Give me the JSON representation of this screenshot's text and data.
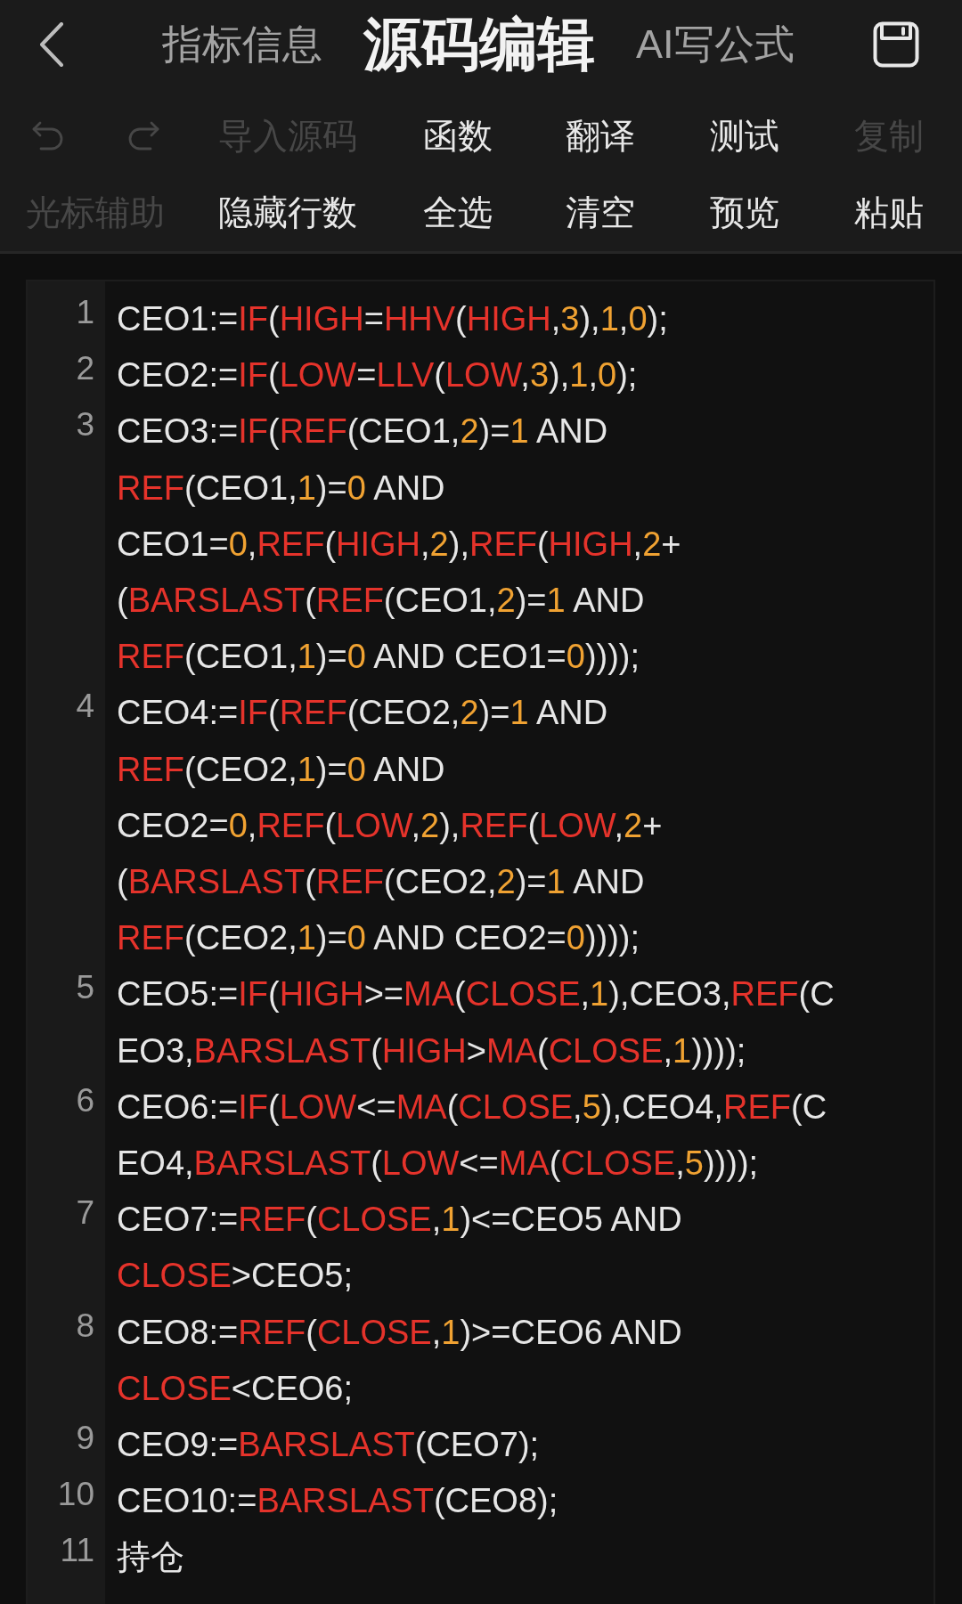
{
  "header": {
    "tabs": [
      {
        "label": "指标信息",
        "selected": false
      },
      {
        "label": "源码编辑",
        "selected": true
      },
      {
        "label": "AI写公式",
        "selected": false
      }
    ]
  },
  "toolbar": {
    "undo": {
      "disabled": true
    },
    "redo": {
      "disabled": true
    },
    "upper_row": [
      {
        "label": "导入源码",
        "disabled": true
      },
      {
        "label": "函数",
        "disabled": false
      },
      {
        "label": "翻译",
        "disabled": false
      },
      {
        "label": "测试",
        "disabled": false
      },
      {
        "label": "复制",
        "disabled": true
      }
    ],
    "lower_row": [
      {
        "label": "光标辅助",
        "disabled": true
      },
      {
        "label": "隐藏行数",
        "disabled": false
      },
      {
        "label": "全选",
        "disabled": false
      },
      {
        "label": "清空",
        "disabled": false
      },
      {
        "label": "预览",
        "disabled": false
      },
      {
        "label": "粘贴",
        "disabled": false
      }
    ]
  },
  "editor": {
    "lines": [
      {
        "number": "1",
        "rows": [
          {
            "tokens": [
              {
                "text": "CEO1:=",
                "kind": "plain"
              },
              {
                "text": "IF",
                "kind": "function"
              },
              {
                "text": "(",
                "kind": "plain"
              },
              {
                "text": "HIGH",
                "kind": "function"
              },
              {
                "text": "=",
                "kind": "plain"
              },
              {
                "text": "HHV",
                "kind": "function"
              },
              {
                "text": "(",
                "kind": "plain"
              },
              {
                "text": "HIGH",
                "kind": "function"
              },
              {
                "text": ",",
                "kind": "plain"
              },
              {
                "text": "3",
                "kind": "number"
              },
              {
                "text": "),",
                "kind": "plain"
              },
              {
                "text": "1",
                "kind": "number"
              },
              {
                "text": ",",
                "kind": "plain"
              },
              {
                "text": "0",
                "kind": "number"
              },
              {
                "text": ");",
                "kind": "plain"
              }
            ]
          }
        ]
      },
      {
        "number": "2",
        "rows": [
          {
            "tokens": [
              {
                "text": "CEO2:=",
                "kind": "plain"
              },
              {
                "text": "IF",
                "kind": "function"
              },
              {
                "text": "(",
                "kind": "plain"
              },
              {
                "text": "LOW",
                "kind": "function"
              },
              {
                "text": "=",
                "kind": "plain"
              },
              {
                "text": "LLV",
                "kind": "function"
              },
              {
                "text": "(",
                "kind": "plain"
              },
              {
                "text": "LOW",
                "kind": "function"
              },
              {
                "text": ",",
                "kind": "plain"
              },
              {
                "text": "3",
                "kind": "number"
              },
              {
                "text": "),",
                "kind": "plain"
              },
              {
                "text": "1",
                "kind": "number"
              },
              {
                "text": ",",
                "kind": "plain"
              },
              {
                "text": "0",
                "kind": "number"
              },
              {
                "text": ");",
                "kind": "plain"
              }
            ]
          }
        ]
      },
      {
        "number": "3",
        "rows": [
          {
            "tokens": [
              {
                "text": "CEO3:=",
                "kind": "plain"
              },
              {
                "text": "IF",
                "kind": "function"
              },
              {
                "text": "(",
                "kind": "plain"
              },
              {
                "text": "REF",
                "kind": "function"
              },
              {
                "text": "(CEO1,",
                "kind": "plain"
              },
              {
                "text": "2",
                "kind": "number"
              },
              {
                "text": ")=",
                "kind": "plain"
              },
              {
                "text": "1",
                "kind": "number"
              },
              {
                "text": " AND",
                "kind": "plain"
              }
            ]
          },
          {
            "tokens": [
              {
                "text": "REF",
                "kind": "function"
              },
              {
                "text": "(CEO1,",
                "kind": "plain"
              },
              {
                "text": "1",
                "kind": "number"
              },
              {
                "text": ")=",
                "kind": "plain"
              },
              {
                "text": "0",
                "kind": "number"
              },
              {
                "text": " AND",
                "kind": "plain"
              }
            ]
          },
          {
            "tokens": [
              {
                "text": "CEO1=",
                "kind": "plain"
              },
              {
                "text": "0",
                "kind": "number"
              },
              {
                "text": ",",
                "kind": "plain"
              },
              {
                "text": "REF",
                "kind": "function"
              },
              {
                "text": "(",
                "kind": "plain"
              },
              {
                "text": "HIGH",
                "kind": "function"
              },
              {
                "text": ",",
                "kind": "plain"
              },
              {
                "text": "2",
                "kind": "number"
              },
              {
                "text": "),",
                "kind": "plain"
              },
              {
                "text": "REF",
                "kind": "function"
              },
              {
                "text": "(",
                "kind": "plain"
              },
              {
                "text": "HIGH",
                "kind": "function"
              },
              {
                "text": ",",
                "kind": "plain"
              },
              {
                "text": "2",
                "kind": "number"
              },
              {
                "text": "+",
                "kind": "plain"
              }
            ]
          },
          {
            "tokens": [
              {
                "text": "(",
                "kind": "plain"
              },
              {
                "text": "BARSLAST",
                "kind": "function"
              },
              {
                "text": "(",
                "kind": "plain"
              },
              {
                "text": "REF",
                "kind": "function"
              },
              {
                "text": "(CEO1,",
                "kind": "plain"
              },
              {
                "text": "2",
                "kind": "number"
              },
              {
                "text": ")=",
                "kind": "plain"
              },
              {
                "text": "1",
                "kind": "number"
              },
              {
                "text": " AND",
                "kind": "plain"
              }
            ]
          },
          {
            "tokens": [
              {
                "text": "REF",
                "kind": "function"
              },
              {
                "text": "(CEO1,",
                "kind": "plain"
              },
              {
                "text": "1",
                "kind": "number"
              },
              {
                "text": ")=",
                "kind": "plain"
              },
              {
                "text": "0",
                "kind": "number"
              },
              {
                "text": " AND CEO1=",
                "kind": "plain"
              },
              {
                "text": "0",
                "kind": "number"
              },
              {
                "text": "))));",
                "kind": "plain"
              }
            ]
          }
        ]
      },
      {
        "number": "4",
        "rows": [
          {
            "tokens": [
              {
                "text": "CEO4:=",
                "kind": "plain"
              },
              {
                "text": "IF",
                "kind": "function"
              },
              {
                "text": "(",
                "kind": "plain"
              },
              {
                "text": "REF",
                "kind": "function"
              },
              {
                "text": "(CEO2,",
                "kind": "plain"
              },
              {
                "text": "2",
                "kind": "number"
              },
              {
                "text": ")=",
                "kind": "plain"
              },
              {
                "text": "1",
                "kind": "number"
              },
              {
                "text": " AND",
                "kind": "plain"
              }
            ]
          },
          {
            "tokens": [
              {
                "text": "REF",
                "kind": "function"
              },
              {
                "text": "(CEO2,",
                "kind": "plain"
              },
              {
                "text": "1",
                "kind": "number"
              },
              {
                "text": ")=",
                "kind": "plain"
              },
              {
                "text": "0",
                "kind": "number"
              },
              {
                "text": " AND",
                "kind": "plain"
              }
            ]
          },
          {
            "tokens": [
              {
                "text": "CEO2=",
                "kind": "plain"
              },
              {
                "text": "0",
                "kind": "number"
              },
              {
                "text": ",",
                "kind": "plain"
              },
              {
                "text": "REF",
                "kind": "function"
              },
              {
                "text": "(",
                "kind": "plain"
              },
              {
                "text": "LOW",
                "kind": "function"
              },
              {
                "text": ",",
                "kind": "plain"
              },
              {
                "text": "2",
                "kind": "number"
              },
              {
                "text": "),",
                "kind": "plain"
              },
              {
                "text": "REF",
                "kind": "function"
              },
              {
                "text": "(",
                "kind": "plain"
              },
              {
                "text": "LOW",
                "kind": "function"
              },
              {
                "text": ",",
                "kind": "plain"
              },
              {
                "text": "2",
                "kind": "number"
              },
              {
                "text": "+",
                "kind": "plain"
              }
            ]
          },
          {
            "tokens": [
              {
                "text": "(",
                "kind": "plain"
              },
              {
                "text": "BARSLAST",
                "kind": "function"
              },
              {
                "text": "(",
                "kind": "plain"
              },
              {
                "text": "REF",
                "kind": "function"
              },
              {
                "text": "(CEO2,",
                "kind": "plain"
              },
              {
                "text": "2",
                "kind": "number"
              },
              {
                "text": ")=",
                "kind": "plain"
              },
              {
                "text": "1",
                "kind": "number"
              },
              {
                "text": " AND",
                "kind": "plain"
              }
            ]
          },
          {
            "tokens": [
              {
                "text": "REF",
                "kind": "function"
              },
              {
                "text": "(CEO2,",
                "kind": "plain"
              },
              {
                "text": "1",
                "kind": "number"
              },
              {
                "text": ")=",
                "kind": "plain"
              },
              {
                "text": "0",
                "kind": "number"
              },
              {
                "text": " AND CEO2=",
                "kind": "plain"
              },
              {
                "text": "0",
                "kind": "number"
              },
              {
                "text": "))));",
                "kind": "plain"
              }
            ]
          }
        ]
      },
      {
        "number": "5",
        "rows": [
          {
            "tokens": [
              {
                "text": "CEO5:=",
                "kind": "plain"
              },
              {
                "text": "IF",
                "kind": "function"
              },
              {
                "text": "(",
                "kind": "plain"
              },
              {
                "text": "HIGH",
                "kind": "function"
              },
              {
                "text": ">=",
                "kind": "plain"
              },
              {
                "text": "MA",
                "kind": "function"
              },
              {
                "text": "(",
                "kind": "plain"
              },
              {
                "text": "CLOSE",
                "kind": "function"
              },
              {
                "text": ",",
                "kind": "plain"
              },
              {
                "text": "1",
                "kind": "number"
              },
              {
                "text": "),CEO3,",
                "kind": "plain"
              },
              {
                "text": "REF",
                "kind": "function"
              },
              {
                "text": "(C",
                "kind": "plain"
              }
            ]
          },
          {
            "tokens": [
              {
                "text": "EO3,",
                "kind": "plain"
              },
              {
                "text": "BARSLAST",
                "kind": "function"
              },
              {
                "text": "(",
                "kind": "plain"
              },
              {
                "text": "HIGH",
                "kind": "function"
              },
              {
                "text": ">",
                "kind": "plain"
              },
              {
                "text": "MA",
                "kind": "function"
              },
              {
                "text": "(",
                "kind": "plain"
              },
              {
                "text": "CLOSE",
                "kind": "function"
              },
              {
                "text": ",",
                "kind": "plain"
              },
              {
                "text": "1",
                "kind": "number"
              },
              {
                "text": "))));",
                "kind": "plain"
              }
            ]
          }
        ]
      },
      {
        "number": "6",
        "rows": [
          {
            "tokens": [
              {
                "text": "CEO6:=",
                "kind": "plain"
              },
              {
                "text": "IF",
                "kind": "function"
              },
              {
                "text": "(",
                "kind": "plain"
              },
              {
                "text": "LOW",
                "kind": "function"
              },
              {
                "text": "<=",
                "kind": "plain"
              },
              {
                "text": "MA",
                "kind": "function"
              },
              {
                "text": "(",
                "kind": "plain"
              },
              {
                "text": "CLOSE",
                "kind": "function"
              },
              {
                "text": ",",
                "kind": "plain"
              },
              {
                "text": "5",
                "kind": "number"
              },
              {
                "text": "),CEO4,",
                "kind": "plain"
              },
              {
                "text": "REF",
                "kind": "function"
              },
              {
                "text": "(C",
                "kind": "plain"
              }
            ]
          },
          {
            "tokens": [
              {
                "text": "EO4,",
                "kind": "plain"
              },
              {
                "text": "BARSLAST",
                "kind": "function"
              },
              {
                "text": "(",
                "kind": "plain"
              },
              {
                "text": "LOW",
                "kind": "function"
              },
              {
                "text": "<=",
                "kind": "plain"
              },
              {
                "text": "MA",
                "kind": "function"
              },
              {
                "text": "(",
                "kind": "plain"
              },
              {
                "text": "CLOSE",
                "kind": "function"
              },
              {
                "text": ",",
                "kind": "plain"
              },
              {
                "text": "5",
                "kind": "number"
              },
              {
                "text": "))));",
                "kind": "plain"
              }
            ]
          }
        ]
      },
      {
        "number": "7",
        "rows": [
          {
            "tokens": [
              {
                "text": "CEO7:=",
                "kind": "plain"
              },
              {
                "text": "REF",
                "kind": "function"
              },
              {
                "text": "(",
                "kind": "plain"
              },
              {
                "text": "CLOSE",
                "kind": "function"
              },
              {
                "text": ",",
                "kind": "plain"
              },
              {
                "text": "1",
                "kind": "number"
              },
              {
                "text": ")<=CEO5 AND",
                "kind": "plain"
              }
            ]
          },
          {
            "tokens": [
              {
                "text": "CLOSE",
                "kind": "function"
              },
              {
                "text": ">CEO5;",
                "kind": "plain"
              }
            ]
          }
        ]
      },
      {
        "number": "8",
        "rows": [
          {
            "tokens": [
              {
                "text": "CEO8:=",
                "kind": "plain"
              },
              {
                "text": "REF",
                "kind": "function"
              },
              {
                "text": "(",
                "kind": "plain"
              },
              {
                "text": "CLOSE",
                "kind": "function"
              },
              {
                "text": ",",
                "kind": "plain"
              },
              {
                "text": "1",
                "kind": "number"
              },
              {
                "text": ")>=CEO6 AND",
                "kind": "plain"
              }
            ]
          },
          {
            "tokens": [
              {
                "text": "CLOSE",
                "kind": "function"
              },
              {
                "text": "<CEO6;",
                "kind": "plain"
              }
            ]
          }
        ]
      },
      {
        "number": "9",
        "rows": [
          {
            "tokens": [
              {
                "text": "CEO9:=",
                "kind": "plain"
              },
              {
                "text": "BARSLAST",
                "kind": "function"
              },
              {
                "text": "(CEO7);",
                "kind": "plain"
              }
            ]
          }
        ]
      },
      {
        "number": "10",
        "rows": [
          {
            "tokens": [
              {
                "text": "CEO10:=",
                "kind": "plain"
              },
              {
                "text": "BARSLAST",
                "kind": "function"
              },
              {
                "text": "(CEO8);",
                "kind": "plain"
              }
            ]
          }
        ]
      },
      {
        "number": "11",
        "rows": [
          {
            "tokens": [
              {
                "text": "持仓",
                "kind": "plain"
              }
            ]
          }
        ]
      }
    ]
  }
}
